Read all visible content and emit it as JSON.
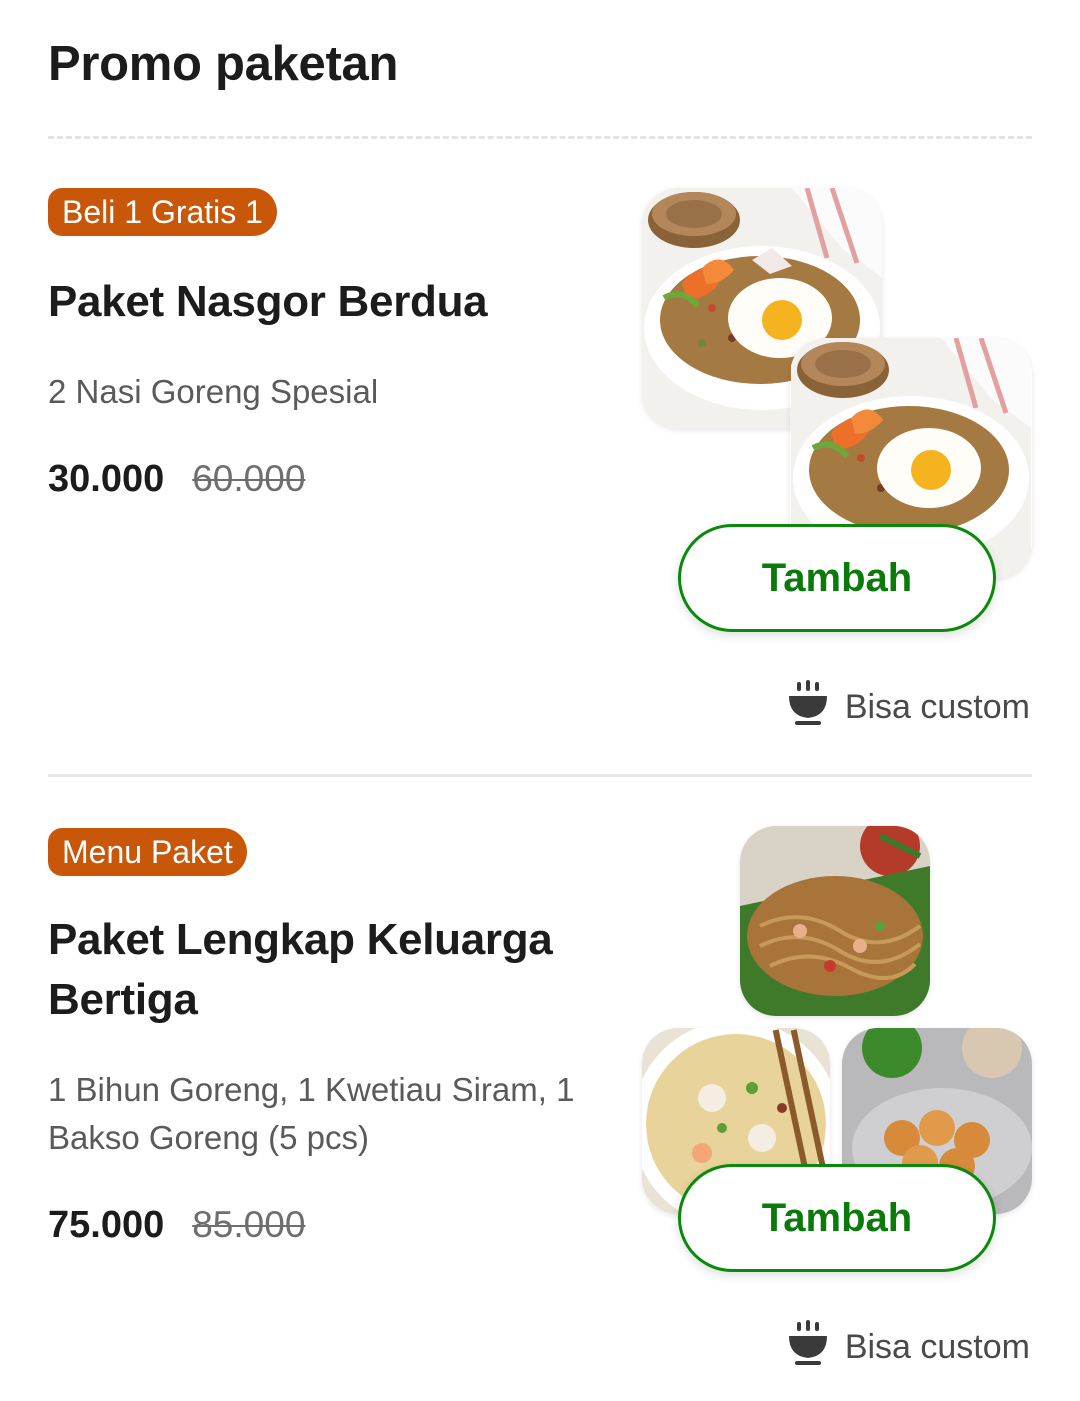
{
  "section": {
    "title": "Promo paketan"
  },
  "items": [
    {
      "badge": "Beli 1 Gratis 1",
      "title": "Paket Nasgor Berdua",
      "description": "2 Nasi Goreng Spesial",
      "price": "30.000",
      "original_price": "60.000",
      "add_label": "Tambah",
      "custom_label": "Bisa custom",
      "images": [
        "fried-rice-image",
        "fried-rice-image"
      ]
    },
    {
      "badge": "Menu Paket",
      "title": "Paket Lengkap Keluarga Bertiga",
      "description": "1 Bihun Goreng, 1 Kwetiau Siram, 1 Bakso Goreng (5 pcs)",
      "price": "75.000",
      "original_price": "85.000",
      "add_label": "Tambah",
      "custom_label": "Bisa custom",
      "images": [
        "fried-vermicelli-image",
        "kwetiau-soup-image",
        "fried-meatball-image"
      ]
    }
  ],
  "colors": {
    "badge": "#c9570a",
    "accent_green": "#0a8a0a",
    "text": "#1c1c1c"
  },
  "icons": {
    "custom": "bowl-icon"
  }
}
